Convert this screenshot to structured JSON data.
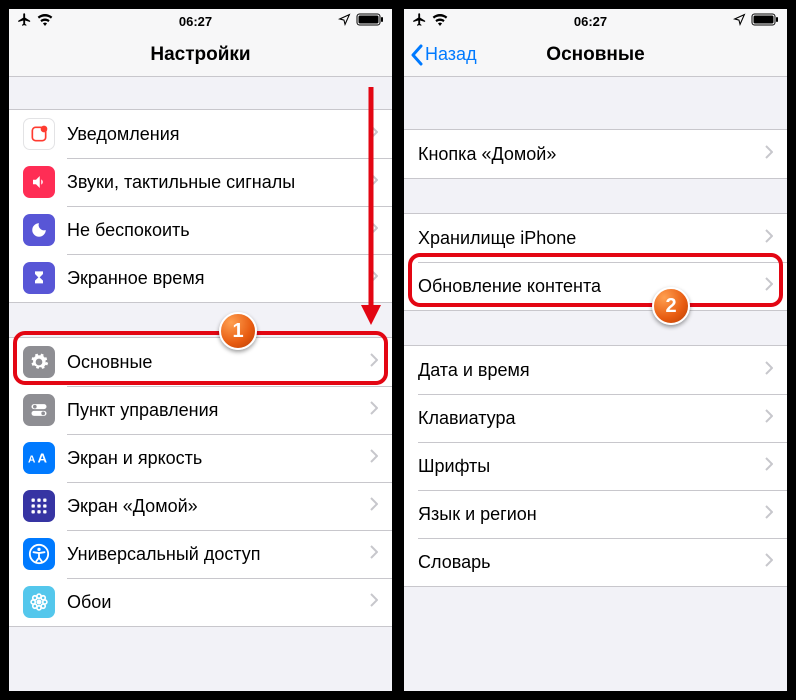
{
  "status": {
    "time": "06:27"
  },
  "left": {
    "title": "Настройки",
    "group1": [
      {
        "label": "Уведомления"
      },
      {
        "label": "Звуки, тактильные сигналы"
      },
      {
        "label": "Не беспокоить"
      },
      {
        "label": "Экранное время"
      }
    ],
    "group2": [
      {
        "label": "Основные"
      },
      {
        "label": "Пункт управления"
      },
      {
        "label": "Экран и яркость"
      },
      {
        "label": "Экран «Домой»"
      },
      {
        "label": "Универсальный доступ"
      },
      {
        "label": "Обои"
      }
    ],
    "badge": "1"
  },
  "right": {
    "back": "Назад",
    "title": "Основные",
    "group1": [
      {
        "label": "Кнопка «Домой»"
      }
    ],
    "group2": [
      {
        "label": "Хранилище iPhone"
      },
      {
        "label": "Обновление контента"
      }
    ],
    "group3": [
      {
        "label": "Дата и время"
      },
      {
        "label": "Клавиатура"
      },
      {
        "label": "Шрифты"
      },
      {
        "label": "Язык и регион"
      },
      {
        "label": "Словарь"
      }
    ],
    "badge": "2"
  }
}
